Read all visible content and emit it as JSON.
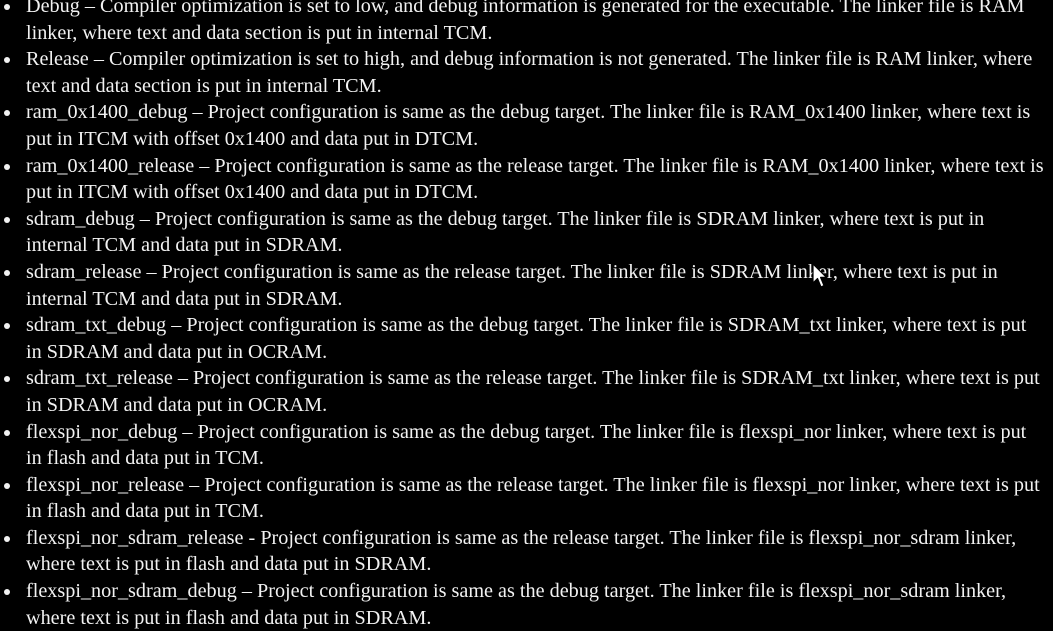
{
  "bullets": [
    {
      "text": "Debug – Compiler optimization is set to low, and debug information is generated for the executable. The linker file is RAM linker, where text and data section is put in internal TCM."
    },
    {
      "text": "Release – Compiler optimization is set to high, and debug information is not generated. The linker file is RAM linker, where text and data section is put in internal TCM."
    },
    {
      "text": "ram_0x1400_debug – Project configuration is same as the debug target. The linker file is RAM_0x1400 linker, where text is put in ITCM with offset 0x1400 and data put in DTCM."
    },
    {
      "text": "ram_0x1400_release – Project configuration is same as the release target. The linker file is RAM_0x1400 linker, where text is put in ITCM with offset 0x1400 and data put in DTCM."
    },
    {
      "text": "sdram_debug – Project configuration is same as the debug target. The linker file is SDRAM linker, where text is put in internal TCM and data put in SDRAM."
    },
    {
      "text": "sdram_release – Project configuration is same as the release target. The linker file is SDRAM linker, where text is put in internal TCM and data put in SDRAM."
    },
    {
      "text": "sdram_txt_debug – Project configuration is same as the debug target. The linker file is SDRAM_txt linker, where text is put in SDRAM and data put in OCRAM."
    },
    {
      "text": "sdram_txt_release – Project configuration is same as the release target. The linker file is SDRAM_txt linker, where text is put in SDRAM and data put in OCRAM."
    },
    {
      "text": "flexspi_nor_debug – Project configuration is same as the debug target. The linker file is flexspi_nor linker, where text is put in flash and data put in TCM."
    },
    {
      "text": "flexspi_nor_release – Project configuration is same as the release target. The linker file is flexspi_nor linker, where text is put in flash and data put in TCM."
    },
    {
      "text": "flexspi_nor_sdram_release - Project configuration is same as the release target. The linker file is flexspi_nor_sdram linker, where text is put in flash and data put in SDRAM."
    },
    {
      "text": "flexspi_nor_sdram_debug – Project configuration is same as the debug target. The linker file is flexspi_nor_sdram linker, where text is put in flash and data put in SDRAM."
    }
  ],
  "colors": {
    "background": "#000000",
    "text": "#f2f2f2"
  },
  "icons": {
    "cursor": "mouse-pointer-icon"
  }
}
